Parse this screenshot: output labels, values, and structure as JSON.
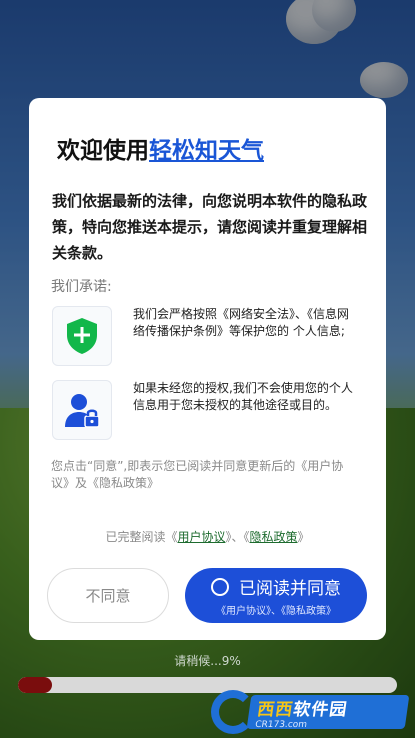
{
  "dialog": {
    "title_prefix": "欢迎使用",
    "app_name": "轻松知天气",
    "intro": "我们依据最新的法律，向您说明本软件的隐私政策，特向您推送本提示，请您阅读并重复理解相关条款。",
    "promise_label": "我们承诺:",
    "items": [
      {
        "icon": "shield-plus-icon",
        "text": "我们会严格按照《网络安全法》、《信息网络传播保护条例》等保护您的 个人信息;"
      },
      {
        "icon": "user-lock-icon",
        "text": "如果未经您的授权,我们不会使用您的个人信息用于您未授权的其他途径或目的。"
      }
    ],
    "notice": "您点击“同意”,即表示您已阅读并同意更新后的《用户协议》及《隐私政策》",
    "read_prefix": "已完整阅读《",
    "user_agreement": "用户协议",
    "read_middle": "》、《",
    "privacy_policy": "隐私政策",
    "read_suffix": "》",
    "disagree_label": "不同意",
    "agree_label": "已阅读并同意",
    "agree_sub": "《用户协议》、《隐私政策》"
  },
  "loading": {
    "text": "请稍候...9%",
    "progress": 0.09
  },
  "watermark": {
    "title_part1": "西西",
    "title_part2": "软件园",
    "url": "CR173.com"
  },
  "colors": {
    "accent": "#1d4fd8",
    "link": "#1d6b2e",
    "progress": "#7a0d0d"
  }
}
